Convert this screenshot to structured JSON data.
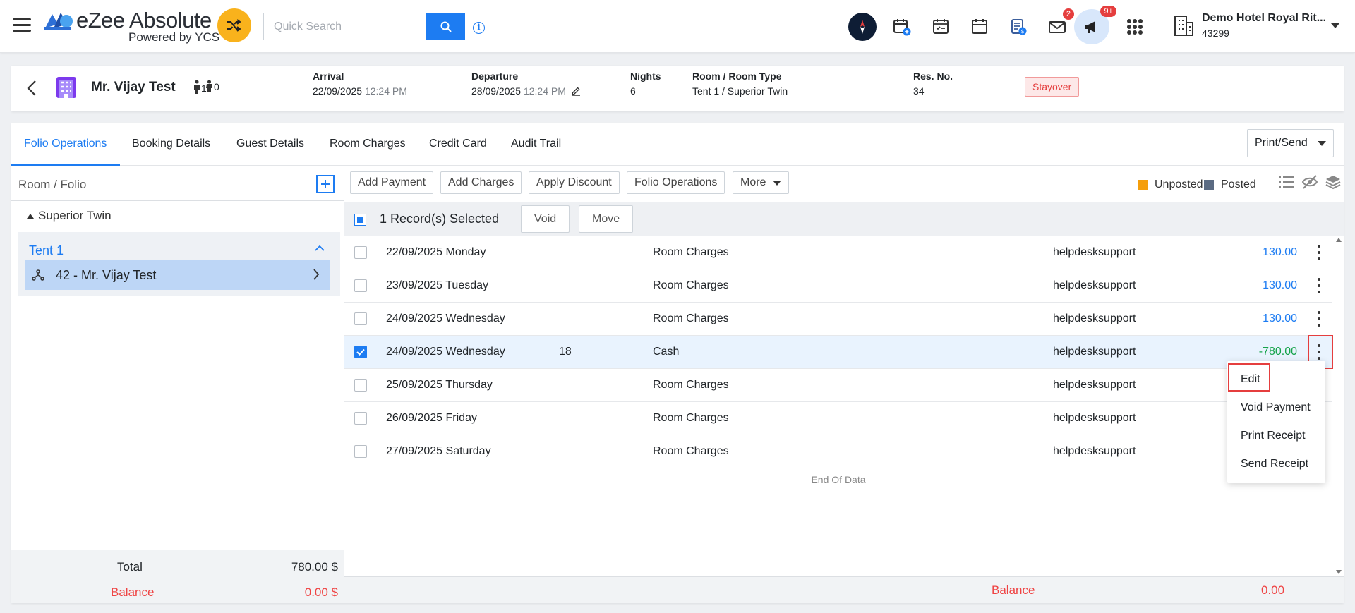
{
  "app": {
    "logo_title": "eZee Absolute",
    "logo_subtitle": "Powered by YCS",
    "search_placeholder": "Quick Search",
    "mail_badge": "2",
    "announce_badge": "9+",
    "hotel_name": "Demo Hotel Royal Rit...",
    "hotel_id": "43299"
  },
  "reservation": {
    "guest_name": "Mr. Vijay Test",
    "adults": "1",
    "children": "0",
    "arrival_label": "Arrival",
    "arrival_date": "22/09/2025",
    "arrival_time": "12:24 PM",
    "departure_label": "Departure",
    "departure_date": "28/09/2025",
    "departure_time": "12:24 PM",
    "nights_label": "Nights",
    "nights": "6",
    "room_label": "Room / Room Type",
    "room_value": "Tent 1 / Superior Twin",
    "resno_label": "Res. No.",
    "resno": "34",
    "status": "Stayover"
  },
  "tabs": [
    "Folio Operations",
    "Booking Details",
    "Guest Details",
    "Room Charges",
    "Credit Card",
    "Audit Trail"
  ],
  "print_send": "Print/Send",
  "left": {
    "title": "Room / Folio",
    "room_type": "Superior Twin",
    "room_name": "Tent 1",
    "folio": "42 - Mr. Vijay Test",
    "total_label": "Total",
    "total_value": "780.00 $",
    "balance_label": "Balance",
    "balance_value": "0.00 $"
  },
  "toolbar": {
    "add_payment": "Add Payment",
    "add_charges": "Add Charges",
    "apply_discount": "Apply Discount",
    "folio_operations": "Folio Operations",
    "more": "More",
    "unposted": "Unposted",
    "posted": "Posted",
    "unposted_color": "#f59e0b",
    "posted_color": "#5b6b82"
  },
  "selection": {
    "text": "1 Record(s) Selected",
    "void": "Void",
    "move": "Move"
  },
  "rows": [
    {
      "date": "22/09/2025 Monday",
      "ref": "",
      "desc": "Room Charges",
      "user": "helpdesksupport",
      "amount": "130.00"
    },
    {
      "date": "23/09/2025 Tuesday",
      "ref": "",
      "desc": "Room Charges",
      "user": "helpdesksupport",
      "amount": "130.00"
    },
    {
      "date": "24/09/2025 Wednesday",
      "ref": "",
      "desc": "Room Charges",
      "user": "helpdesksupport",
      "amount": "130.00"
    },
    {
      "date": "24/09/2025 Wednesday",
      "ref": "18",
      "desc": "Cash",
      "user": "helpdesksupport",
      "amount": "-780.00"
    },
    {
      "date": "25/09/2025 Thursday",
      "ref": "",
      "desc": "Room Charges",
      "user": "helpdesksupport",
      "amount": ""
    },
    {
      "date": "26/09/2025 Friday",
      "ref": "",
      "desc": "Room Charges",
      "user": "helpdesksupport",
      "amount": ""
    },
    {
      "date": "27/09/2025 Saturday",
      "ref": "",
      "desc": "Room Charges",
      "user": "helpdesksupport",
      "amount": ""
    }
  ],
  "end_of_data": "End Of Data",
  "footer": {
    "balance_label": "Balance",
    "balance_value": "0.00"
  },
  "popup": [
    "Edit",
    "Void Payment",
    "Print Receipt",
    "Send Receipt"
  ]
}
